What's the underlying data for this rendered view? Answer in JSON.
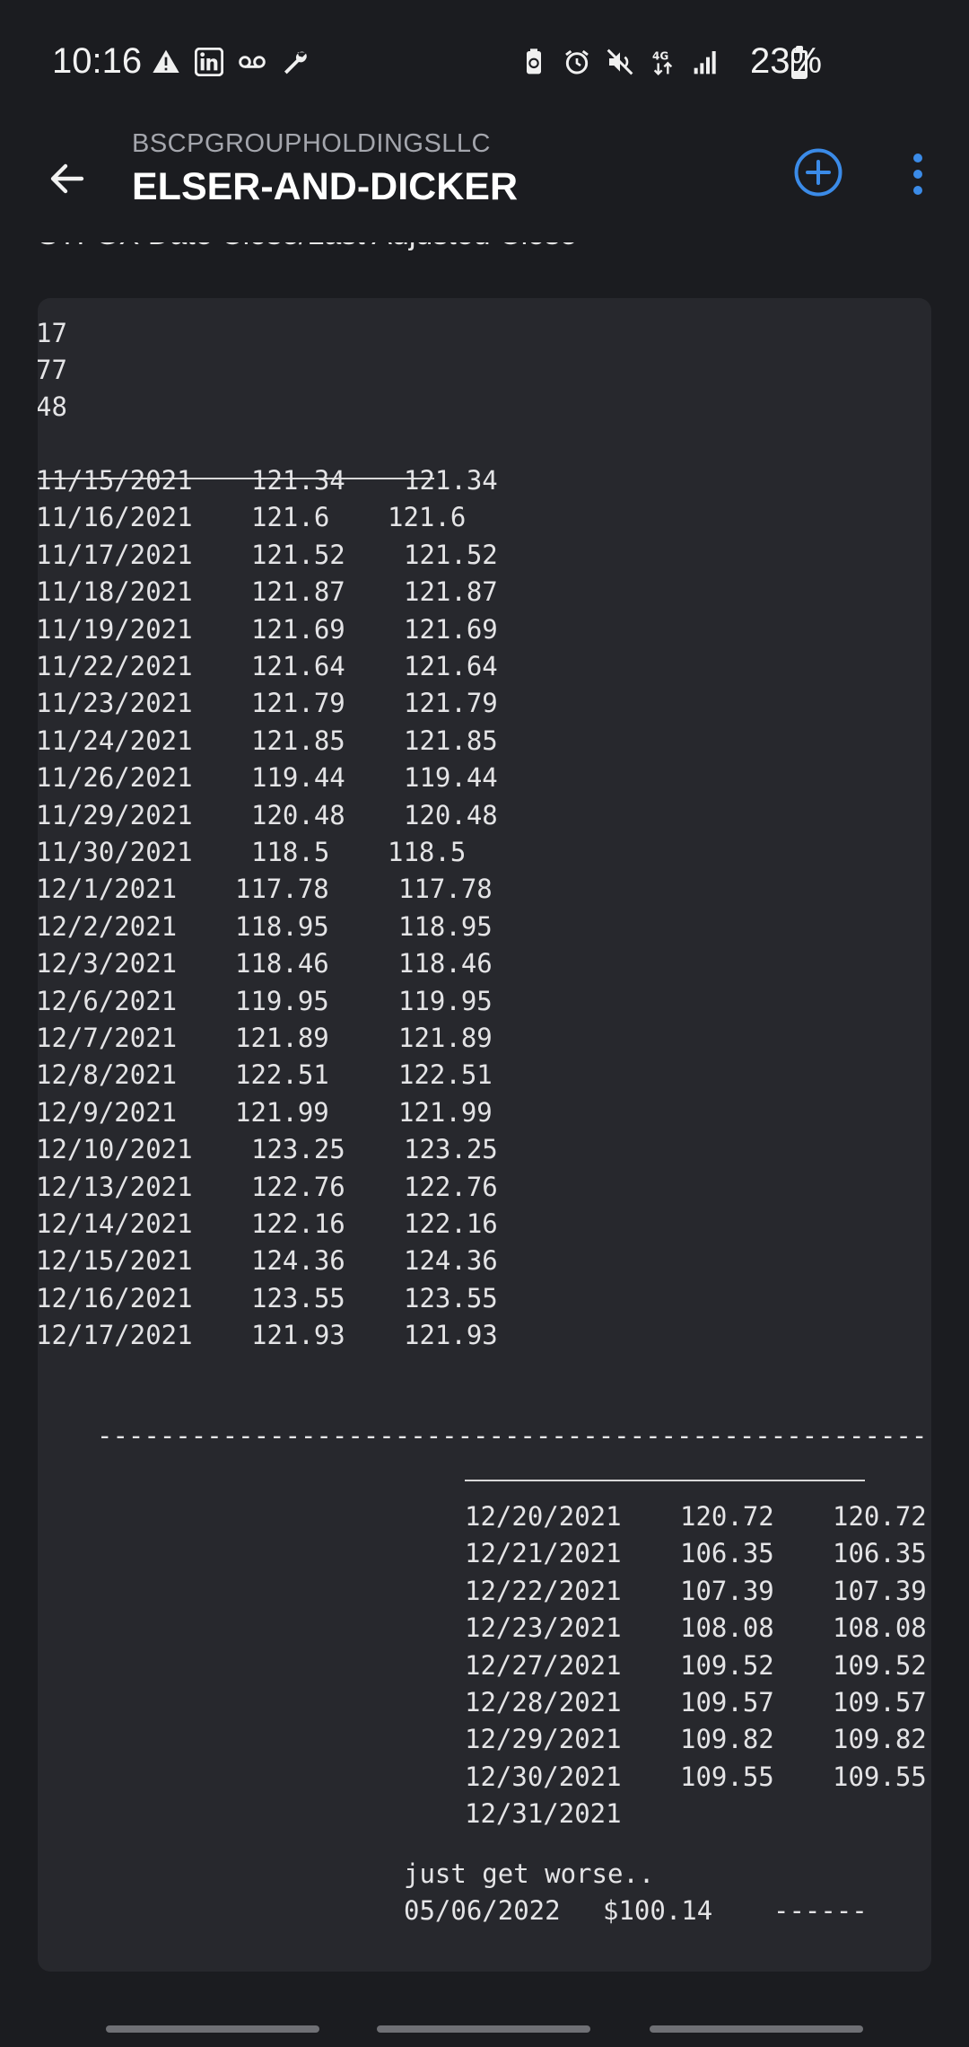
{
  "status_bar": {
    "time": "10:16",
    "battery_percent": "23%",
    "battery_level": 0.23,
    "left_icons": [
      "warning-icon",
      "linkedin-icon",
      "voicemail-icon",
      "wrench-icon"
    ],
    "right_icons": [
      "battery-saver-icon",
      "alarm-icon",
      "mute-icon",
      "data-4g-icon",
      "signal-icon"
    ]
  },
  "app_bar": {
    "subtitle": "BSCPGROUPHOLDINGSLLC",
    "title": "ELSER-AND-DICKER",
    "accent_color": "#3b8be8"
  },
  "post": {
    "heading": "STFGX Date Close/Last Adjusted Close",
    "fragments": [
      "17",
      "77",
      "48"
    ],
    "rows": [
      {
        "date": "11/15/2021",
        "close": "121.34",
        "adj": "121.34"
      },
      {
        "date": "11/16/2021",
        "close": "121.6",
        "adj": "121.6"
      },
      {
        "date": "11/17/2021",
        "close": "121.52",
        "adj": "121.52"
      },
      {
        "date": "11/18/2021",
        "close": "121.87",
        "adj": "121.87"
      },
      {
        "date": "11/19/2021",
        "close": "121.69",
        "adj": "121.69"
      },
      {
        "date": "11/22/2021",
        "close": "121.64",
        "adj": "121.64"
      },
      {
        "date": "11/23/2021",
        "close": "121.79",
        "adj": "121.79"
      },
      {
        "date": "11/24/2021",
        "close": "121.85",
        "adj": "121.85"
      },
      {
        "date": "11/26/2021",
        "close": "119.44",
        "adj": "119.44"
      },
      {
        "date": "11/29/2021",
        "close": "120.48",
        "adj": "120.48"
      },
      {
        "date": "11/30/2021",
        "close": "118.5",
        "adj": "118.5"
      },
      {
        "date": "12/1/2021",
        "close": "117.78",
        "adj": "117.78"
      },
      {
        "date": "12/2/2021",
        "close": "118.95",
        "adj": "118.95"
      },
      {
        "date": "12/3/2021",
        "close": "118.46",
        "adj": "118.46"
      },
      {
        "date": "12/6/2021",
        "close": "119.95",
        "adj": "119.95"
      },
      {
        "date": "12/7/2021",
        "close": "121.89",
        "adj": "121.89"
      },
      {
        "date": "12/8/2021",
        "close": "122.51",
        "adj": "122.51"
      },
      {
        "date": "12/9/2021",
        "close": "121.99",
        "adj": "121.99"
      },
      {
        "date": "12/10/2021",
        "close": "123.25",
        "adj": "123.25"
      },
      {
        "date": "12/13/2021",
        "close": "122.76",
        "adj": "122.76"
      },
      {
        "date": "12/14/2021",
        "close": "122.16",
        "adj": "122.16"
      },
      {
        "date": "12/15/2021",
        "close": "124.36",
        "adj": "124.36"
      },
      {
        "date": "12/16/2021",
        "close": "123.55",
        "adj": "123.55"
      },
      {
        "date": "12/17/2021",
        "close": "121.93",
        "adj": "121.93"
      }
    ],
    "dash_line": "------------------------------------------------------------",
    "rows2": [
      {
        "date": "12/20/2021",
        "close": "120.72",
        "adj": "120.72"
      },
      {
        "date": "12/21/2021",
        "close": "106.35",
        "adj": "106.35"
      },
      {
        "date": "12/22/2021",
        "close": "107.39",
        "adj": "107.39"
      },
      {
        "date": "12/23/2021",
        "close": "108.08",
        "adj": "108.08"
      },
      {
        "date": "12/27/2021",
        "close": "109.52",
        "adj": "109.52"
      },
      {
        "date": "12/28/2021",
        "close": "109.57",
        "adj": "109.57"
      },
      {
        "date": "12/29/2021",
        "close": "109.82",
        "adj": "109.82"
      },
      {
        "date": "12/30/2021",
        "close": "109.55",
        "adj": "109.55"
      },
      {
        "date": "12/31/2021",
        "close": "",
        "adj": ""
      }
    ],
    "note": "just get worse..",
    "final_date": "05/06/2022",
    "final_price": "$100.14",
    "final_dashes": "------"
  }
}
